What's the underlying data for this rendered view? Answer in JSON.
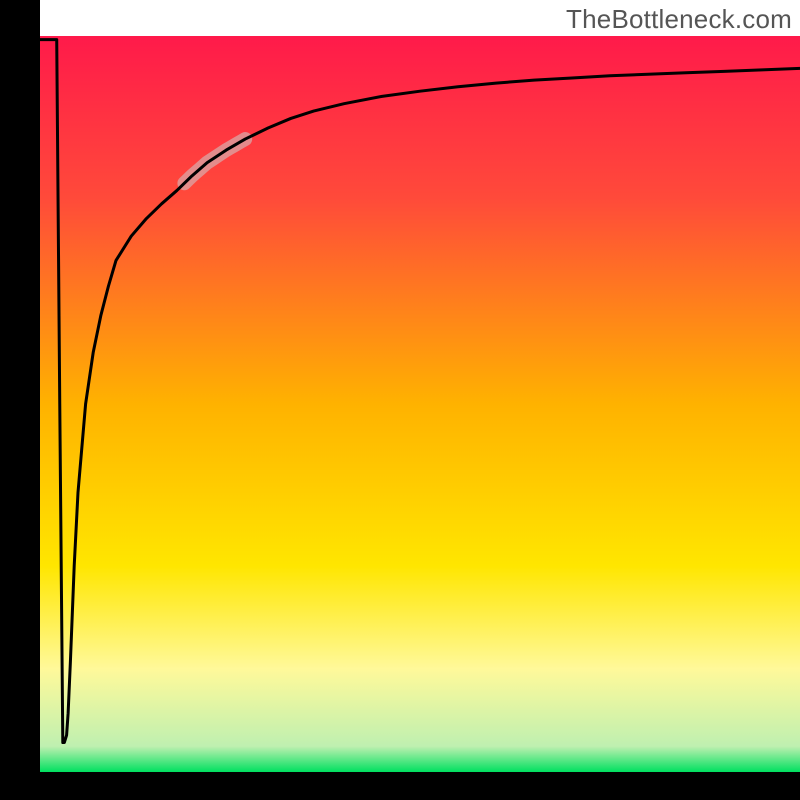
{
  "watermark": "TheBottleneck.com",
  "chart_data": {
    "type": "line",
    "title": "",
    "xlabel": "",
    "ylabel": "",
    "xlim": [
      0,
      100
    ],
    "ylim": [
      0,
      100
    ],
    "background_gradient": {
      "top_color": "#ff1a4a",
      "mid_color": "#ffe600",
      "bottom_color": "#00e060",
      "stops": [
        {
          "offset": 0.0,
          "color": "#ff1a4a"
        },
        {
          "offset": 0.22,
          "color": "#ff4a3a"
        },
        {
          "offset": 0.5,
          "color": "#ffb200"
        },
        {
          "offset": 0.72,
          "color": "#ffe600"
        },
        {
          "offset": 0.86,
          "color": "#fff99a"
        },
        {
          "offset": 0.965,
          "color": "#bff0b0"
        },
        {
          "offset": 1.0,
          "color": "#00e060"
        }
      ]
    },
    "plot_inset": {
      "left_frac": 0.05,
      "right_frac": 1.0,
      "top_frac": 0.045,
      "bottom_frac": 0.965
    },
    "series": [
      {
        "name": "curve",
        "color": "#000000",
        "stroke_width": 3,
        "x": [
          0.02,
          2.2,
          2.6,
          3.0,
          3.2,
          3.5,
          3.7,
          4.0,
          4.5,
          5.0,
          6.0,
          7.0,
          8.0,
          9.0,
          10.0,
          12.0,
          14.0,
          16.0,
          18.0,
          20.0,
          22.0,
          24.5,
          27.0,
          30.0,
          33.0,
          36.0,
          40.0,
          45.0,
          50.0,
          55.0,
          60.0,
          65.0,
          70.0,
          75.0,
          80.0,
          85.0,
          90.0,
          95.0,
          100.0
        ],
        "y": [
          99.5,
          99.5,
          50.0,
          4.0,
          4.0,
          5.0,
          8.0,
          15.0,
          28.0,
          38.0,
          50.0,
          57.0,
          62.0,
          66.0,
          69.5,
          72.8,
          75.2,
          77.2,
          79.0,
          81.0,
          82.8,
          84.5,
          86.0,
          87.5,
          88.8,
          89.8,
          90.8,
          91.8,
          92.5,
          93.1,
          93.6,
          94.0,
          94.3,
          94.6,
          94.8,
          95.0,
          95.2,
          95.4,
          95.6
        ]
      }
    ],
    "highlight": {
      "color": "#d9a7a7",
      "stroke_width": 14,
      "opacity": 0.75,
      "x_range": [
        19.0,
        27.0
      ]
    },
    "annotations": []
  }
}
